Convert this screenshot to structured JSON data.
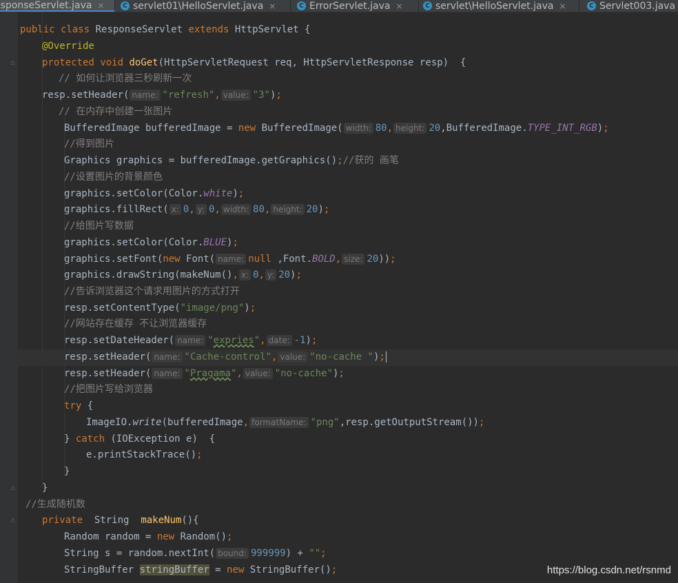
{
  "tabs": [
    {
      "label": "esponseServlet.java",
      "active": true
    },
    {
      "label": "servlet01\\HelloServlet.java",
      "active": false
    },
    {
      "label": "ErrorServlet.java",
      "active": false
    },
    {
      "label": "servlet\\HelloServlet.java",
      "active": false
    },
    {
      "label": "Servlet003.java",
      "active": false
    }
  ],
  "tab_icon_letter": "C",
  "tab_close": "×",
  "colors": {
    "background": "#2b2b2b",
    "keyword": "#cc7832",
    "string": "#6a8759",
    "number": "#6897bb",
    "comment": "#808080",
    "method": "#ffc66d",
    "annotation": "#bbb529",
    "constant": "#9876aa"
  },
  "code": {
    "l1": {
      "kw": "public class",
      "t1": " ResponseServlet ",
      "kw2": "extends",
      "t2": " HttpServlet {"
    },
    "l2": {
      "ann": "@Override"
    },
    "l3": {
      "kw": "protected void",
      "fn": "doGet",
      "t": "(HttpServletRequest req, HttpServletResponse resp)  {"
    },
    "l4": {
      "cmt": "// 如何让浏览器三秒刷新一次"
    },
    "l5": {
      "t1": "resp.setHeader(",
      "h1": "name:",
      "s1": "\"refresh\"",
      "c1": ",",
      "h2": "value:",
      "s2": "\"3\"",
      "t2": ")",
      "semi": ";"
    },
    "l6": {
      "cmt": "// 在内存中创建一张图片"
    },
    "l7": {
      "t1": "BufferedImage bufferedImage = ",
      "kw": "new",
      "t2": " BufferedImage(",
      "h1": "width:",
      "n1": "80",
      "c1": ",",
      "h2": "height:",
      "n2": "20",
      "t3": ",BufferedImage.",
      "const": "TYPE_INT_RGB",
      "t4": ")",
      "semi": ";"
    },
    "l8": {
      "cmt": "//得到图片"
    },
    "l9": {
      "t": "Graphics graphics = bufferedImage.getGraphics()",
      "semi": ";",
      "cmt": "//获的 画笔"
    },
    "l10": {
      "cmt": "//设置图片的背景颜色"
    },
    "l11": {
      "t1": "graphics.setColor(Color.",
      "const": "white",
      "t2": ")",
      "semi": ";"
    },
    "l12": {
      "t1": "graphics.fillRect(",
      "h1": "x:",
      "n1": "0",
      "c1": ",",
      "h2": "y:",
      "n2": "0",
      "c2": ",",
      "h3": "width:",
      "n3": "80",
      "c3": ",",
      "h4": "height:",
      "n4": "20",
      "t2": ")",
      "semi": ";"
    },
    "l13": {
      "cmt": "//给图片写数据"
    },
    "l14": {
      "t1": "graphics.setColor(Color.",
      "const": "BLUE",
      "t2": ")",
      "semi": ";"
    },
    "l15": {
      "t1": "graphics.setFont(",
      "kw": "new",
      "t2": " Font(",
      "h1": "name:",
      "kw2": "null",
      "t3": " ,Font.",
      "const": "BOLD",
      "c1": ",",
      "h2": "size:",
      "n1": "20",
      "t4": "))",
      "semi": ";"
    },
    "l16": {
      "t1": "graphics.drawString(makeNum()",
      "c1": ",",
      "h1": "x:",
      "n1": "0",
      "c2": ",",
      "h2": "y:",
      "n2": "20",
      "t2": ")",
      "semi": ";"
    },
    "l17": {
      "cmt": "//告诉浏览器这个请求用图片的方式打开"
    },
    "l18": {
      "t1": "resp.setContentType(",
      "s1": "\"image/png\"",
      "t2": ")",
      "semi": ";"
    },
    "l19": {
      "cmt": "//网站存在缓存 不让浏览器缓存"
    },
    "l20": {
      "t1": "resp.setDateHeader(",
      "h1": "name:",
      "s1a": "\"",
      "s1b": "expries",
      "s1c": "\"",
      "c1": ",",
      "h2": "date:",
      "n1": "-1",
      "t2": ")",
      "semi": ";"
    },
    "l21": {
      "t1": "resp.setHeader(",
      "h1": "name:",
      "s1": "\"Cache-control\"",
      "c1": ",",
      "h2": "value:",
      "s2": "\"no-cache \"",
      "t2": ")",
      "semi": ";"
    },
    "l22": {
      "t1": "resp.setHeader(",
      "h1": "name:",
      "s1a": "\"",
      "s1b": "Pragama",
      "s1c": "\"",
      "c1": ",",
      "h2": "value:",
      "s2": "\"no-cache\"",
      "t2": ")",
      "semi": ";"
    },
    "l23": {
      "cmt": "//把图片写给浏览器"
    },
    "l24": {
      "kw": "try",
      "t": " {"
    },
    "l25": {
      "t1": "ImageIO.",
      "it": "write",
      "t2": "(bufferedImage",
      "c1": ",",
      "h1": "formatName:",
      "s1": "\"png\"",
      "t3": ",resp.getOutputStream())",
      "semi": ";"
    },
    "l26": {
      "t1": "} ",
      "kw": "catch",
      "t2": " (IOException e)  {"
    },
    "l27": {
      "t": "e.printStackTrace()",
      "semi": ";"
    },
    "l28": {
      "t": "}"
    },
    "l29": {
      "t": "}"
    },
    "l30": {
      "cmt": "//生成随机数"
    },
    "l31": {
      "kw": "private",
      "t1": "  String  ",
      "fn": "makeNum",
      "t2": "(){"
    },
    "l32": {
      "t1": "Random random = ",
      "kw": "new",
      "t2": " Random()",
      "semi": ";"
    },
    "l33": {
      "t1": "String s = random.nextInt(",
      "h1": "bound:",
      "n1": "999999",
      "t2": ") + ",
      "s1": "\"\"",
      "semi": ";"
    },
    "l34": {
      "t1": "StringBuffer ",
      "hl": "stringBuffer",
      "t2": " = ",
      "kw": "new",
      "t3": " StringBuffer()",
      "semi": ";"
    }
  },
  "watermark": "https://blog.csdn.net/rsnmd"
}
